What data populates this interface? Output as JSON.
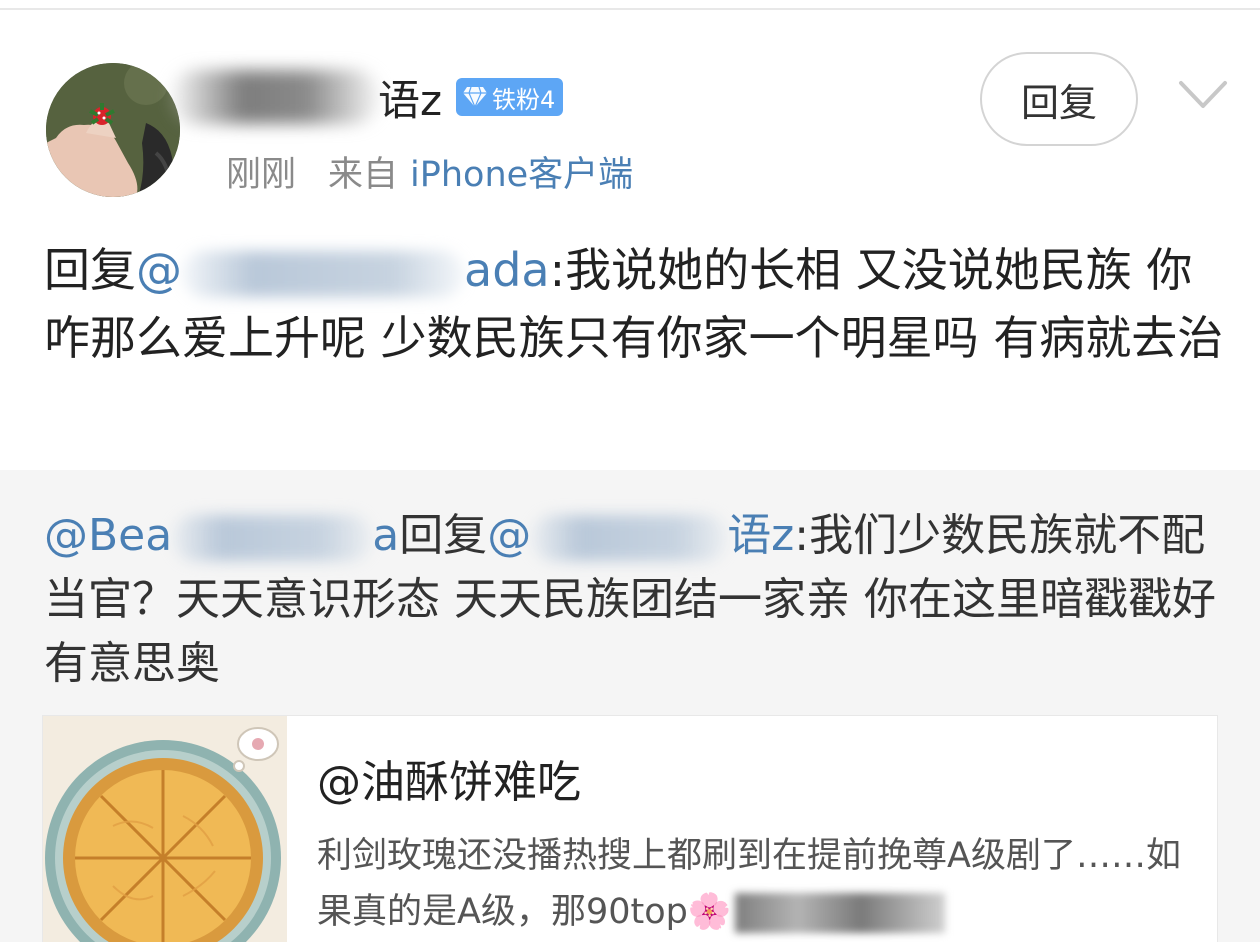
{
  "post": {
    "username_suffix": "语z",
    "fan_badge": "铁粉4",
    "time": "刚刚",
    "from_label": "来自",
    "source": "iPhone客户端",
    "reply_button": "回复",
    "text_prefix": "回复",
    "mention_start": "@",
    "mention_end": "ada",
    "text_body": ":我说她的长相 又没说她民族 你咋那么爱上升呢 少数民族只有你家一个明星吗 有病就去治"
  },
  "quote": {
    "mention_start": "@Bea",
    "mention_end": "a",
    "reply_word": "回复",
    "target_start": "@",
    "target_end": "语z",
    "text_body": ":我们少数民族就不配当官？天天意识形态 天天民族团结一家亲 你在这里暗戳戳好有意思奥"
  },
  "card": {
    "title": "@油酥饼难吃",
    "desc": "利剑玫瑰还没播热搜上都刷到在提前挽尊A级剧了……如果真的是A级，那90top",
    "desc_emoji": "🌸"
  },
  "colors": {
    "link": "#4a7fb4",
    "badge": "#5da6f5",
    "quote_bg": "#f5f5f5"
  }
}
